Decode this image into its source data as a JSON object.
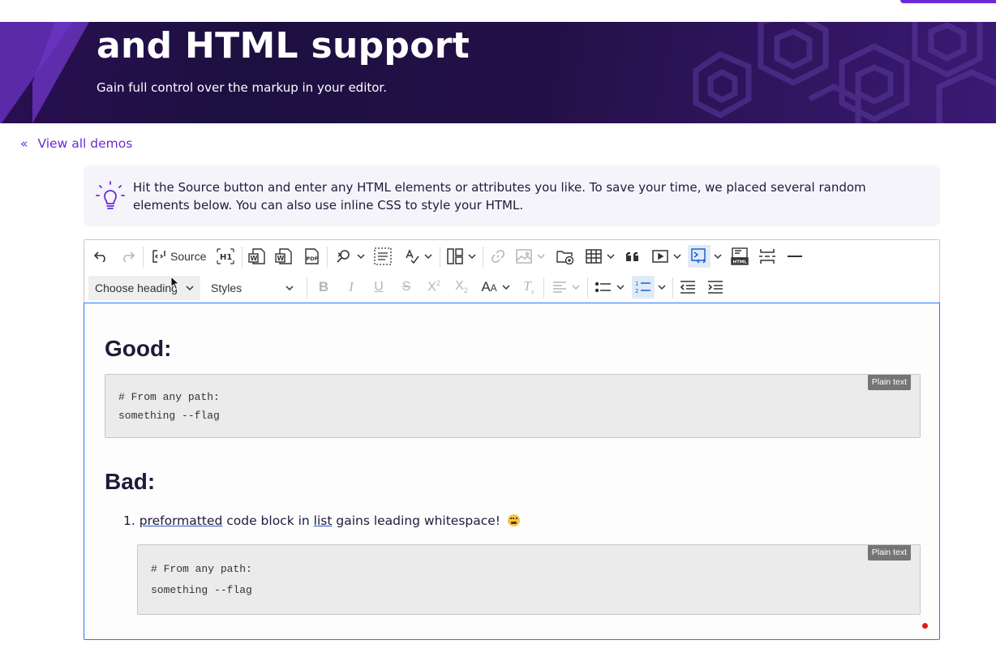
{
  "hero": {
    "title": "and HTML support",
    "subtitle": "Gain full control over the markup in your editor."
  },
  "nav": {
    "back_chevron": "«",
    "back_label": "View all demos"
  },
  "tip": {
    "icon": "lightbulb-icon",
    "text": "Hit the Source button and enter any HTML elements or attributes you like. To save your time, we placed several random elements below. You can also use inline CSS to style your HTML."
  },
  "toolbar": {
    "source_label": "Source",
    "heading_dropdown": "Choose heading",
    "styles_dropdown": "Styles",
    "font_size_label": "AA"
  },
  "content": {
    "heading_good": "Good:",
    "code_block_1": {
      "language": "Plain text",
      "lines": [
        "# From any path:",
        "something --flag"
      ]
    },
    "heading_bad": "Bad:",
    "list": {
      "marker": "1.",
      "word_1": "preformatted",
      "text_1": " code block in ",
      "word_2": "list",
      "text_2": " gains leading whitespace! "
    },
    "code_block_2": {
      "language": "Plain text",
      "lines": [
        "# From any path:",
        "something --flag"
      ]
    }
  },
  "colors": {
    "accent": "#6b2bd3",
    "hero_bg": "#1c1040",
    "focus_border": "#2977ff",
    "status_dot": "#e3191c"
  }
}
